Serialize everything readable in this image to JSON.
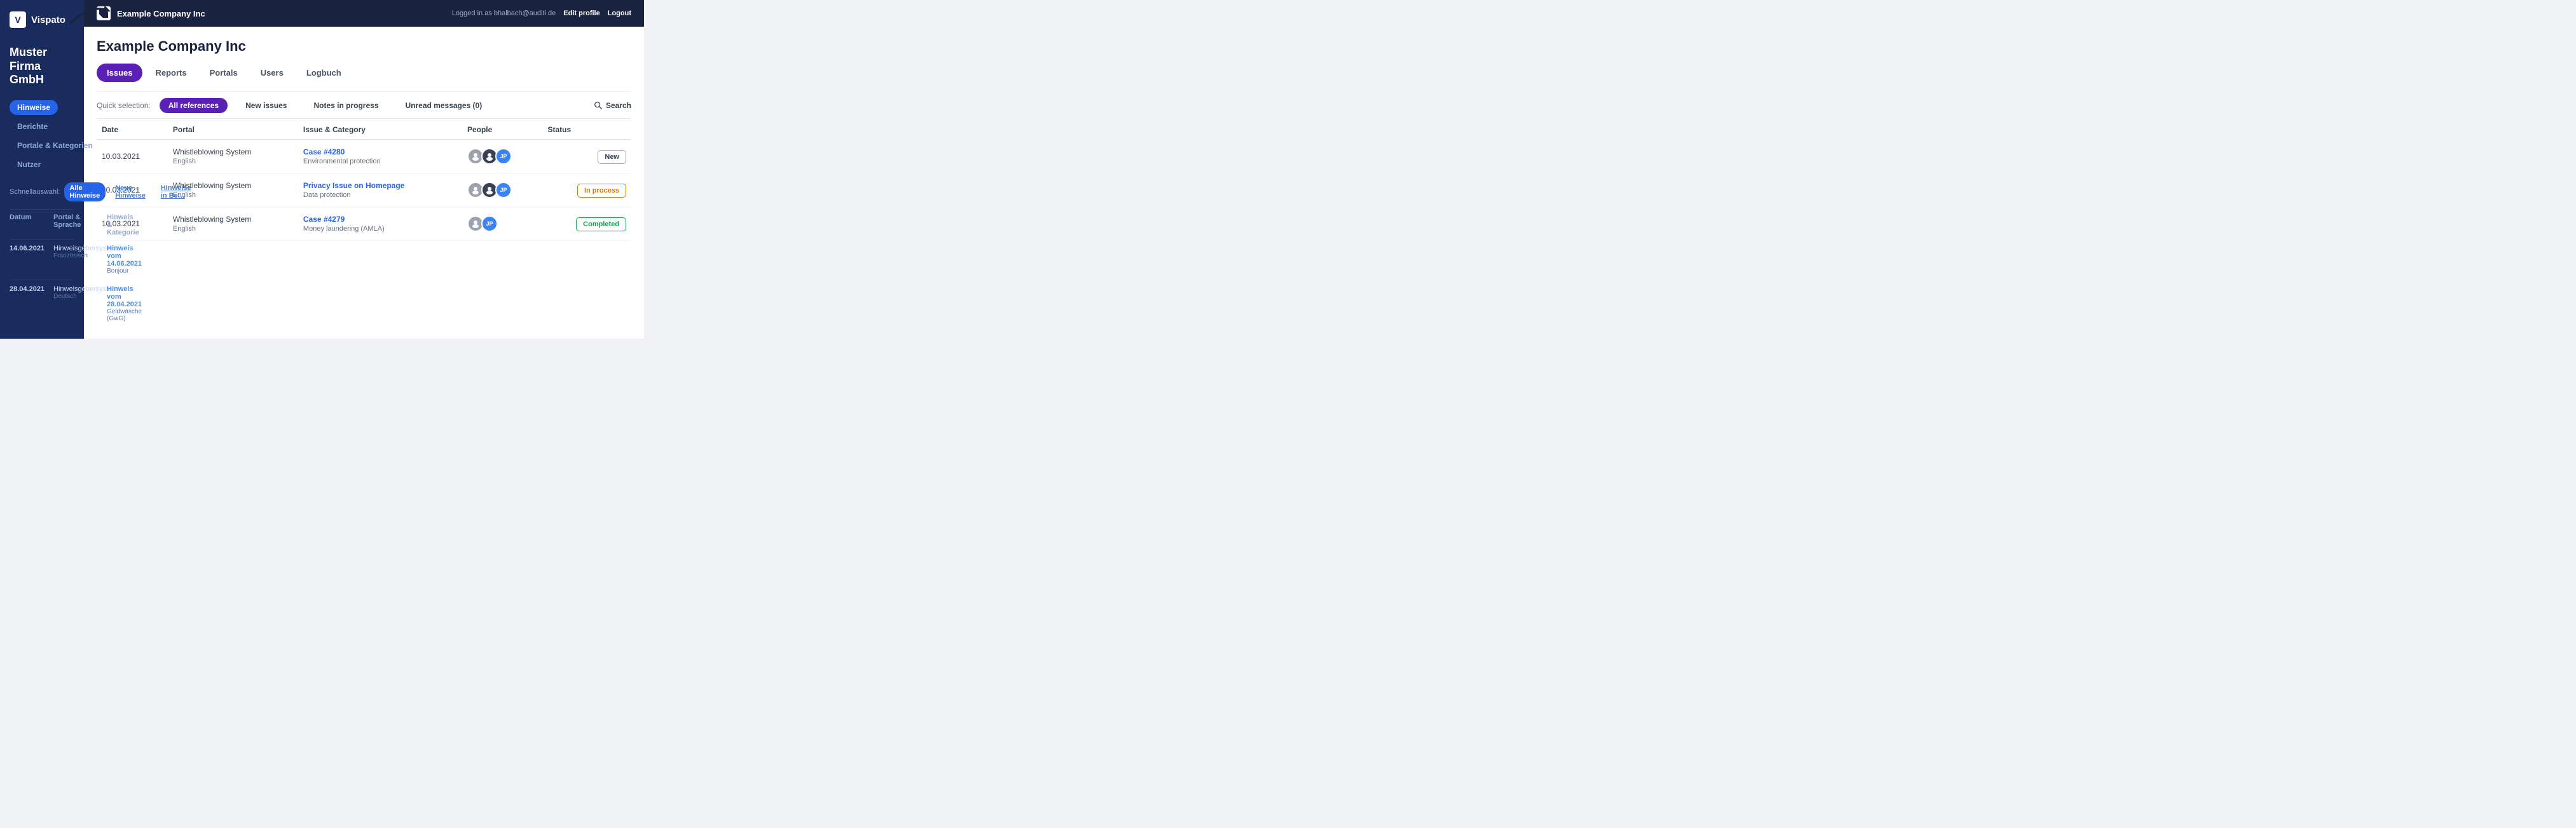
{
  "leftPanel": {
    "logo": {
      "icon": "V",
      "name": "Vispato"
    },
    "companyTitle": "Muster Firma GmbH",
    "tabs": [
      {
        "label": "Hinweise",
        "active": true
      },
      {
        "label": "Berichte",
        "active": false
      },
      {
        "label": "Portale & Kategorien",
        "active": false
      },
      {
        "label": "Nutzer",
        "active": false
      }
    ],
    "quickSelect": {
      "label": "Schnellauswahl:",
      "chips": [
        {
          "label": "Alle Hinweise",
          "active": true
        },
        {
          "label": "Neue Hinweise",
          "active": false
        },
        {
          "label": "Hinweise in Be…",
          "active": false
        }
      ]
    },
    "tableHeaders": [
      "Datum",
      "Portal & Sprache",
      "Hinweis & Kategorie"
    ],
    "rows": [
      {
        "date": "14.06.2021",
        "portal": "Hinweisgebersystem",
        "portalSub": "Französisch",
        "link": "Hinweis vom 14.06.2021",
        "category": "Bonjour"
      },
      {
        "date": "28.04.2021",
        "portal": "Hinweisgebersystem",
        "portalSub": "Deutsch",
        "link": "Hinweis vom 28.04.2021",
        "category": "Geldwäsche (GwG)"
      }
    ]
  },
  "rightPanel": {
    "topBar": {
      "companyName": "Example Company Inc",
      "loggedInText": "Logged in as bhalbach@auditi.de",
      "editProfile": "Edit profile",
      "logout": "Logout"
    },
    "pageTitle": "Example Company Inc",
    "tabs": [
      {
        "label": "Issues",
        "active": true
      },
      {
        "label": "Reports",
        "active": false
      },
      {
        "label": "Portals",
        "active": false
      },
      {
        "label": "Users",
        "active": false
      },
      {
        "label": "Logbuch",
        "active": false
      }
    ],
    "quickSelection": {
      "label": "Quick selection:",
      "chips": [
        {
          "label": "All references",
          "active": true
        },
        {
          "label": "New issues",
          "active": false
        },
        {
          "label": "Notes in progress",
          "active": false
        },
        {
          "label": "Unread messages (0)",
          "active": false
        }
      ],
      "searchLabel": "Search"
    },
    "tableHeaders": {
      "date": "Date",
      "portal": "Portal",
      "issueCategory": "Issue & Category",
      "people": "People",
      "status": "Status"
    },
    "rows": [
      {
        "date": "10.03.2021",
        "portal": "Whistleblowing System",
        "portalSub": "English",
        "issueLink": "Case #4280",
        "category": "Environmental protection",
        "people": [
          "gray",
          "dark",
          "JP"
        ],
        "status": "New",
        "statusClass": "status-new"
      },
      {
        "date": "10.03.2021",
        "portal": "Whistleblowing System",
        "portalSub": "English",
        "issueLink": "Privacy Issue on Homepage",
        "category": "Data protection",
        "people": [
          "gray",
          "dark",
          "JP"
        ],
        "status": "In process",
        "statusClass": "status-inprocess"
      },
      {
        "date": "10.03.2021",
        "portal": "Whistleblowing System",
        "portalSub": "English",
        "issueLink": "Case #4279",
        "category": "Money laundering (AMLA)",
        "people": [
          "gray",
          "JP"
        ],
        "status": "Completed",
        "statusClass": "status-completed"
      }
    ]
  }
}
